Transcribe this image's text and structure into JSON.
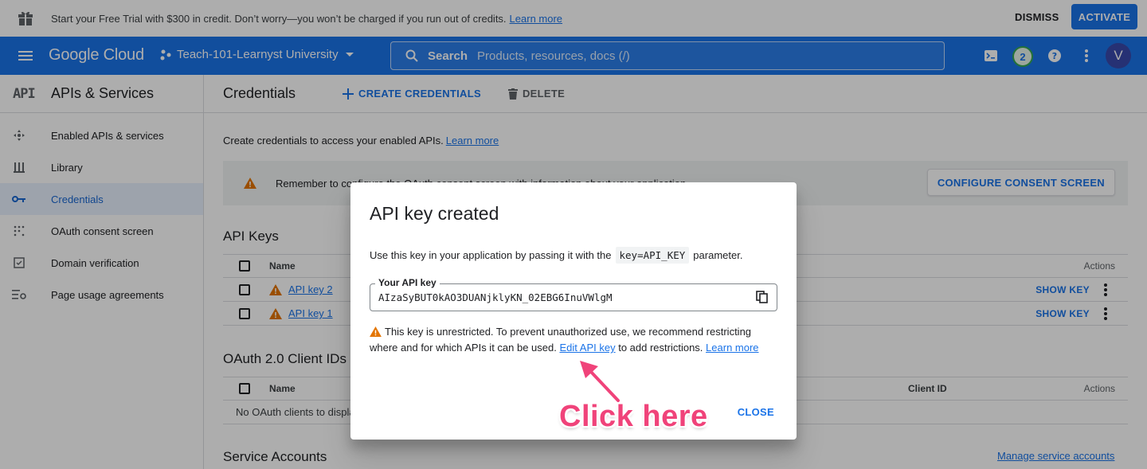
{
  "banner": {
    "message": "Start your Free Trial with $300 in credit. Don’t worry—you won’t be charged if you run out of credits.",
    "learn_more": "Learn more",
    "dismiss": "DISMISS",
    "activate": "ACTIVATE"
  },
  "topbar": {
    "logo": "Google Cloud",
    "project": "Teach-101-Learnyst University",
    "search_label": "Search",
    "search_placeholder": "Products, resources, docs (/)",
    "notification_count": "2",
    "avatar_letter": "V"
  },
  "sidebar": {
    "badge": "API",
    "title": "APIs & Services",
    "items": [
      {
        "label": "Enabled APIs & services",
        "icon": "diamond-arrows-icon"
      },
      {
        "label": "Library",
        "icon": "library-icon"
      },
      {
        "label": "Credentials",
        "icon": "key-icon",
        "active": true
      },
      {
        "label": "OAuth consent screen",
        "icon": "dots-grid-icon"
      },
      {
        "label": "Domain verification",
        "icon": "checkbox-icon"
      },
      {
        "label": "Page usage agreements",
        "icon": "settings-list-icon"
      }
    ]
  },
  "main": {
    "title": "Credentials",
    "create_credentials": "CREATE CREDENTIALS",
    "delete": "DELETE",
    "intro": "Create credentials to access your enabled APIs.",
    "intro_link": "Learn more",
    "warning": "Remember to configure the OAuth consent screen with information about your application.",
    "configure_button": "CONFIGURE CONSENT SCREEN",
    "api_keys_heading": "API Keys",
    "api_keys_columns": {
      "name": "Name",
      "actions": "Actions"
    },
    "api_keys": [
      {
        "name": "API key 2",
        "action": "SHOW KEY"
      },
      {
        "name": "API key 1",
        "action": "SHOW KEY"
      }
    ],
    "oauth_heading": "OAuth 2.0 Client IDs",
    "oauth_columns": {
      "name": "Name",
      "client_id": "Client ID",
      "actions": "Actions"
    },
    "oauth_empty": "No OAuth clients to display",
    "service_heading": "Service Accounts",
    "manage_service_accounts": "Manage service accounts"
  },
  "dialog": {
    "title": "API key created",
    "use_text_before": "Use this key in your application by passing it with the",
    "use_code": "key=API_KEY",
    "use_text_after": "parameter.",
    "field_label": "Your API key",
    "api_key_value": "AIzaSyBUT0kAO3DUANjklyKN_02EBG6InuVWlgM",
    "note_text": "This key is unrestricted. To prevent unauthorized use, we recommend restricting where and for which APIs it can be used.",
    "edit_link": "Edit API key",
    "note_after": "to add restrictions.",
    "note_learn_more": "Learn more",
    "close": "CLOSE"
  },
  "annotation": {
    "callout": "Click here",
    "color": "#f0437a"
  },
  "colors": {
    "brand_blue": "#1a73e8",
    "warning_orange": "#e37400"
  }
}
